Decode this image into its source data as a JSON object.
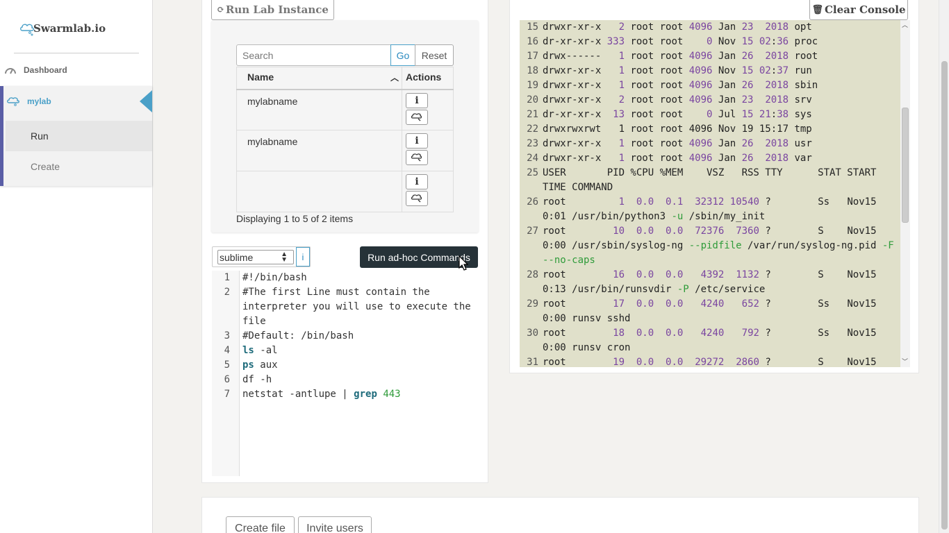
{
  "app": {
    "logo_text": "Swarmlab.io"
  },
  "sidebar": {
    "dashboard_label": "Dashboard",
    "lab_label": "mylab",
    "items": [
      {
        "label": "Run"
      },
      {
        "label": "Create"
      }
    ]
  },
  "left": {
    "run_lab_label": "Run Lab Instance",
    "search": {
      "placeholder": "Search",
      "value": ""
    },
    "go_label": "Go",
    "reset_label": "Reset",
    "table": {
      "headers": {
        "name": "Name",
        "actions": "Actions"
      },
      "rows": [
        {
          "name": "mylabname"
        },
        {
          "name": "mylabname"
        },
        {
          "name": ""
        }
      ]
    },
    "info_button_label": "i",
    "display_info": "Displaying 1 to 5 of 2 items",
    "editor": {
      "theme": "sublime",
      "info_label": "i",
      "run_label": "Run ad-hoc Commands",
      "lines": [
        {
          "n": "1",
          "text": "#!/bin/bash"
        },
        {
          "n": "2",
          "text": "#The first Line must contain the interpreter you will use to execute the file"
        },
        {
          "n": "3",
          "text": "#Default: /bin/bash"
        },
        {
          "n": "4",
          "text": "ls -al"
        },
        {
          "n": "5",
          "text": "ps aux"
        },
        {
          "n": "6",
          "text": "df -h"
        },
        {
          "n": "7",
          "text": "netstat -antlupe | grep 443"
        }
      ]
    }
  },
  "console": {
    "clear_label": "Clear Console",
    "lines": [
      {
        "n": "15",
        "text": "drwxr-xr-x   2 root root 4096 Jan 23  2018 opt"
      },
      {
        "n": "16",
        "text": "dr-xr-xr-x 333 root root    0 Nov 15 02:36 proc"
      },
      {
        "n": "17",
        "text": "drwx------   1 root root 4096 Jan 26  2018 root"
      },
      {
        "n": "18",
        "text": "drwxr-xr-x   1 root root 4096 Nov 15 02:37 run"
      },
      {
        "n": "19",
        "text": "drwxr-xr-x   1 root root 4096 Jan 26  2018 sbin"
      },
      {
        "n": "20",
        "text": "drwxr-xr-x   2 root root 4096 Jan 23  2018 srv"
      },
      {
        "n": "21",
        "text": "dr-xr-xr-x  13 root root    0 Jul 15 21:38 sys"
      },
      {
        "n": "22",
        "text": "drwxrwxrwt   1 root root 4096 Nov 19 15:17 tmp"
      },
      {
        "n": "23",
        "text": "drwxr-xr-x   1 root root 4096 Jan 26  2018 usr"
      },
      {
        "n": "24",
        "text": "drwxr-xr-x   1 root root 4096 Jan 26  2018 var"
      },
      {
        "n": "25",
        "text": "USER       PID %CPU %MEM    VSZ   RSS TTY      STAT START"
      },
      {
        "n": "",
        "text": "TIME COMMAND"
      },
      {
        "n": "26",
        "text": "root         1  0.0  0.1  32312 10540 ?        Ss   Nov15"
      },
      {
        "n": "",
        "text": "0:01 /usr/bin/python3 -u /sbin/my_init"
      },
      {
        "n": "27",
        "text": "root        10  0.0  0.0  72376  7360 ?        S    Nov15"
      },
      {
        "n": "",
        "text": "0:00 /usr/sbin/syslog-ng --pidfile /var/run/syslog-ng.pid -F"
      },
      {
        "n": "",
        "text": "--no-caps"
      },
      {
        "n": "28",
        "text": "root        16  0.0  0.0   4392  1132 ?        S    Nov15"
      },
      {
        "n": "",
        "text": "0:13 /usr/bin/runsvdir -P /etc/service"
      },
      {
        "n": "29",
        "text": "root        17  0.0  0.0   4240   652 ?        Ss   Nov15"
      },
      {
        "n": "",
        "text": "0:00 runsv sshd"
      },
      {
        "n": "30",
        "text": "root        18  0.0  0.0   4240   792 ?        Ss   Nov15"
      },
      {
        "n": "",
        "text": "0:00 runsv cron"
      },
      {
        "n": "31",
        "text": "root        19  0.0  0.0  29272  2860 ?        S    Nov15"
      }
    ]
  },
  "bottom": {
    "create_file_label": "Create file",
    "invite_users_label": "Invite users"
  },
  "colors": {
    "accent": "#4aa0c8",
    "sidebar_active_border": "#5a5ea6",
    "console_bg": "#e0e0ca",
    "run_button_bg": "#263238"
  }
}
